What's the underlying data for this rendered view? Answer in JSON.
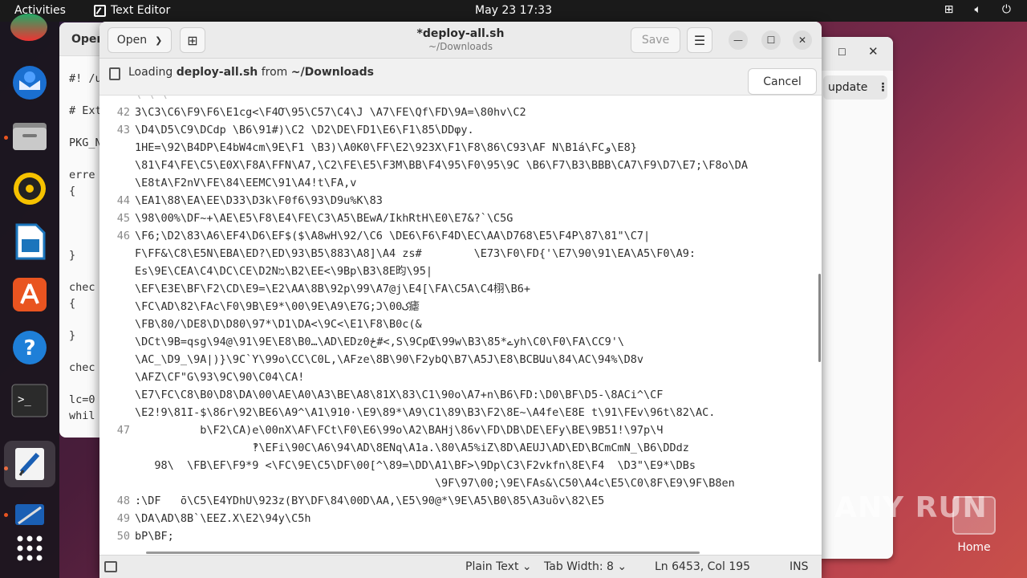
{
  "topbar": {
    "activities": "Activities",
    "app_name": "Text Editor",
    "clock": "May 23  17:33"
  },
  "left_window": {
    "title": "Oper",
    "lines": [
      "#! /u",
      "",
      "# Ext",
      "",
      "PKG_N",
      "",
      "erre",
      "{",
      "",
      "",
      "",
      "}",
      "",
      "chec",
      "{",
      "",
      "}",
      "",
      "chec",
      "",
      "lc=0",
      "whil"
    ]
  },
  "right_window": {
    "update_label": "update"
  },
  "editor": {
    "open_label": "Open",
    "save_label": "Save",
    "title": "*deploy-all.sh",
    "subtitle": "~/Downloads",
    "info": {
      "loading": "Loading ",
      "file": "deploy-all.sh",
      "from": " from ",
      "dir": "~/Downloads"
    },
    "cancel_label": "Cancel",
    "lines": [
      {
        "n": "42",
        "t": "3\\C3\\C6\\F9\\F6\\E1cg<\\F4Ơ\\95\\C57\\C4\\J \\A7\\FE\\Qf\\FD\\9A=\\80hv\\C2"
      },
      {
        "n": "43",
        "t": "\\D4\\D5\\C9\\DCdp \\B6\\91#)\\C2 \\D2\\DE\\FD1\\E6\\F1\\85ٙ\\DDφy."
      },
      {
        "n": "",
        "t": "1HE=\\92\\B4DP\\E4bW4cm\\9E\\F1 \\B3)\\A0K0\\FF\\E2\\923X\\F1\\F8\\86\\C93\\AF N\\B1á\\FCو\\E8}"
      },
      {
        "n": "",
        "t": "\\81\\F4\\FE\\C5\\E0X\\F8A\\FFN\\A7,\\C2\\FE\\E5\\F3M\\BB\\F4\\95\\F0\\95\\9C \\B6\\F7\\B3\\BBB\\CA7\\F9\\D7\\E7;\\F8o\\DA"
      },
      {
        "n": "",
        "t": "\\E8tA\\F2nV\\FE\\84\\EEMC\\91\\A4!t\\FA,v"
      },
      {
        "n": "44",
        "t": "\\EA1\\88\\EA\\EE\\D33\\D3k\\F0f6\\93\\D9u%K\\83"
      },
      {
        "n": "45",
        "t": "\\98\\00%\\DF~+\\AE\\E5\\F8\\E4\\FE\\C3\\A5\\BEwA/IkhRtH\\E0\\E7&?`\\C5G"
      },
      {
        "n": "46",
        "t": "\\F6;\\D2\\83\\A6\\EF4\\D6\\EF$($\\A8wH\\92/\\C6 \\DE6\\F6\\F4D\\EC\\AA\\D768\\E5\\F4P\\87\\81\"\\C7|"
      },
      {
        "n": "",
        "t": "F\\FF&\\C8\\E5N\\EBA\\ED?\\ED\\93\\B5\\883\\A8]\\A4 zs#        \\E73\\F0\\FD{'\\E7\\90\\91\\EA\\A5\\F0\\A9:"
      },
      {
        "n": "",
        "t": "Es\\9E\\CEA\\C4\\DC\\CE\\D2Nמ\\B2\\EE<\\9Bp\\B3\\8E昀\\95|"
      },
      {
        "n": "",
        "t": "\\EF\\E3E\\BF\\F2\\CD\\E9=\\E2\\AA\\8B\\92p\\99\\A7@j\\E4[\\FA\\C5A\\C4栩\\B6+"
      },
      {
        "n": "",
        "t": "\\FC\\AD\\82\\FAc\\F0\\9B\\E9*\\00\\9E\\A9\\E7G;Ɔ\\00ک瘧"
      },
      {
        "n": "",
        "t": "\\FB\\80/\\DE8\\D\\D80\\97*\\D1\\DA<\\9C<\\E1\\F8\\B0c(&"
      },
      {
        "n": "",
        "t": "\\DCt\\9B=qsg\\94@\\91\\9E\\E8\\B0…\\AD\\EDzځ0#<,S\\9CpŒ\\99w\\B3\\85*ےyh\\C0\\F0\\FA\\CC9'\\"
      },
      {
        "n": "",
        "t": "\\AC_\\D9_\\9A|)}\\9C`Y\\99o\\CC\\C0L,\\AFze\\8B\\90\\F2ybQ\\B7\\A5J\\E8\\BCBԱu\\84\\AC\\94%\\D8v"
      },
      {
        "n": "",
        "t": "\\AFZ\\CF\"G\\93\\9C\\90\\C04\\CA!"
      },
      {
        "n": "",
        "t": "\\E7\\FC\\C8\\B0\\D8\\DA\\00\\AE\\A0\\A3\\BE\\A8\\81X\\83\\C1\\90o\\A7+n\\B6\\FD:\\D0\\BF\\D5-\\8ACi^\\CF"
      },
      {
        "n": "",
        "t": "\\E2!9\\81I-$\\86r\\92\\BE6\\A9^\\A1\\910·\\E9\\89*\\A9\\C1\\89\\B3\\F2\\8E~\\A4fe\\E8E t\\91\\FEv\\96t\\82\\AC."
      },
      {
        "n": "47",
        "t": "          b\\F2\\CA)e\\00nX\\AF\\FCt\\F0\\E6\\99o\\A2\\BAHj\\86v\\FD\\DB\\DE\\EFy\\BE\\9B51!\\97p\\Ч"
      },
      {
        "n": "",
        "t": "                  ‽\\EFi\\90C\\A6\\94\\AD\\8ENq\\A1a.\\80\\A5%iZ\\8D\\AEUJ\\AD\\ED\\BCmCmN_\\B6\\DDdz"
      },
      {
        "n": "",
        "t": "   98\\  \\FB\\EF\\F9*9 <\\FC\\9E\\C5\\DF\\00[^\\89=\\DD\\A1\\BF>\\9Dp\\C3\\F2vkfn\\8E\\F4  \\D3\"\\E9*\\DBs"
      },
      {
        "n": "",
        "t": "                                              \\9F\\97\\00;\\9E\\FAs&\\C50\\A4c\\E5\\C0\\8F\\E9\\9F\\B8en"
      },
      {
        "n": "48",
        "t": ":\\DF   ō\\C5\\E4YDhU\\923z(BY\\DF\\84\\00D\\AA,\\E5\\90@*\\9E\\A5\\B0\\85\\A3uὃv\\82\\E5"
      },
      {
        "n": "49",
        "t": "\\DA\\AD\\8B`\\EEZ.X\\E2\\94y\\C5h"
      },
      {
        "n": "50",
        "t": "bP\\BF;"
      }
    ],
    "status": {
      "lang": "Plain Text",
      "tab": "Tab Width: 8",
      "pos": "Ln 6453, Col 195",
      "mode": "INS"
    }
  },
  "watermark": {
    "text": "ANY RUN"
  },
  "desktop": {
    "home_label": "Home"
  },
  "accent": "#e95420"
}
